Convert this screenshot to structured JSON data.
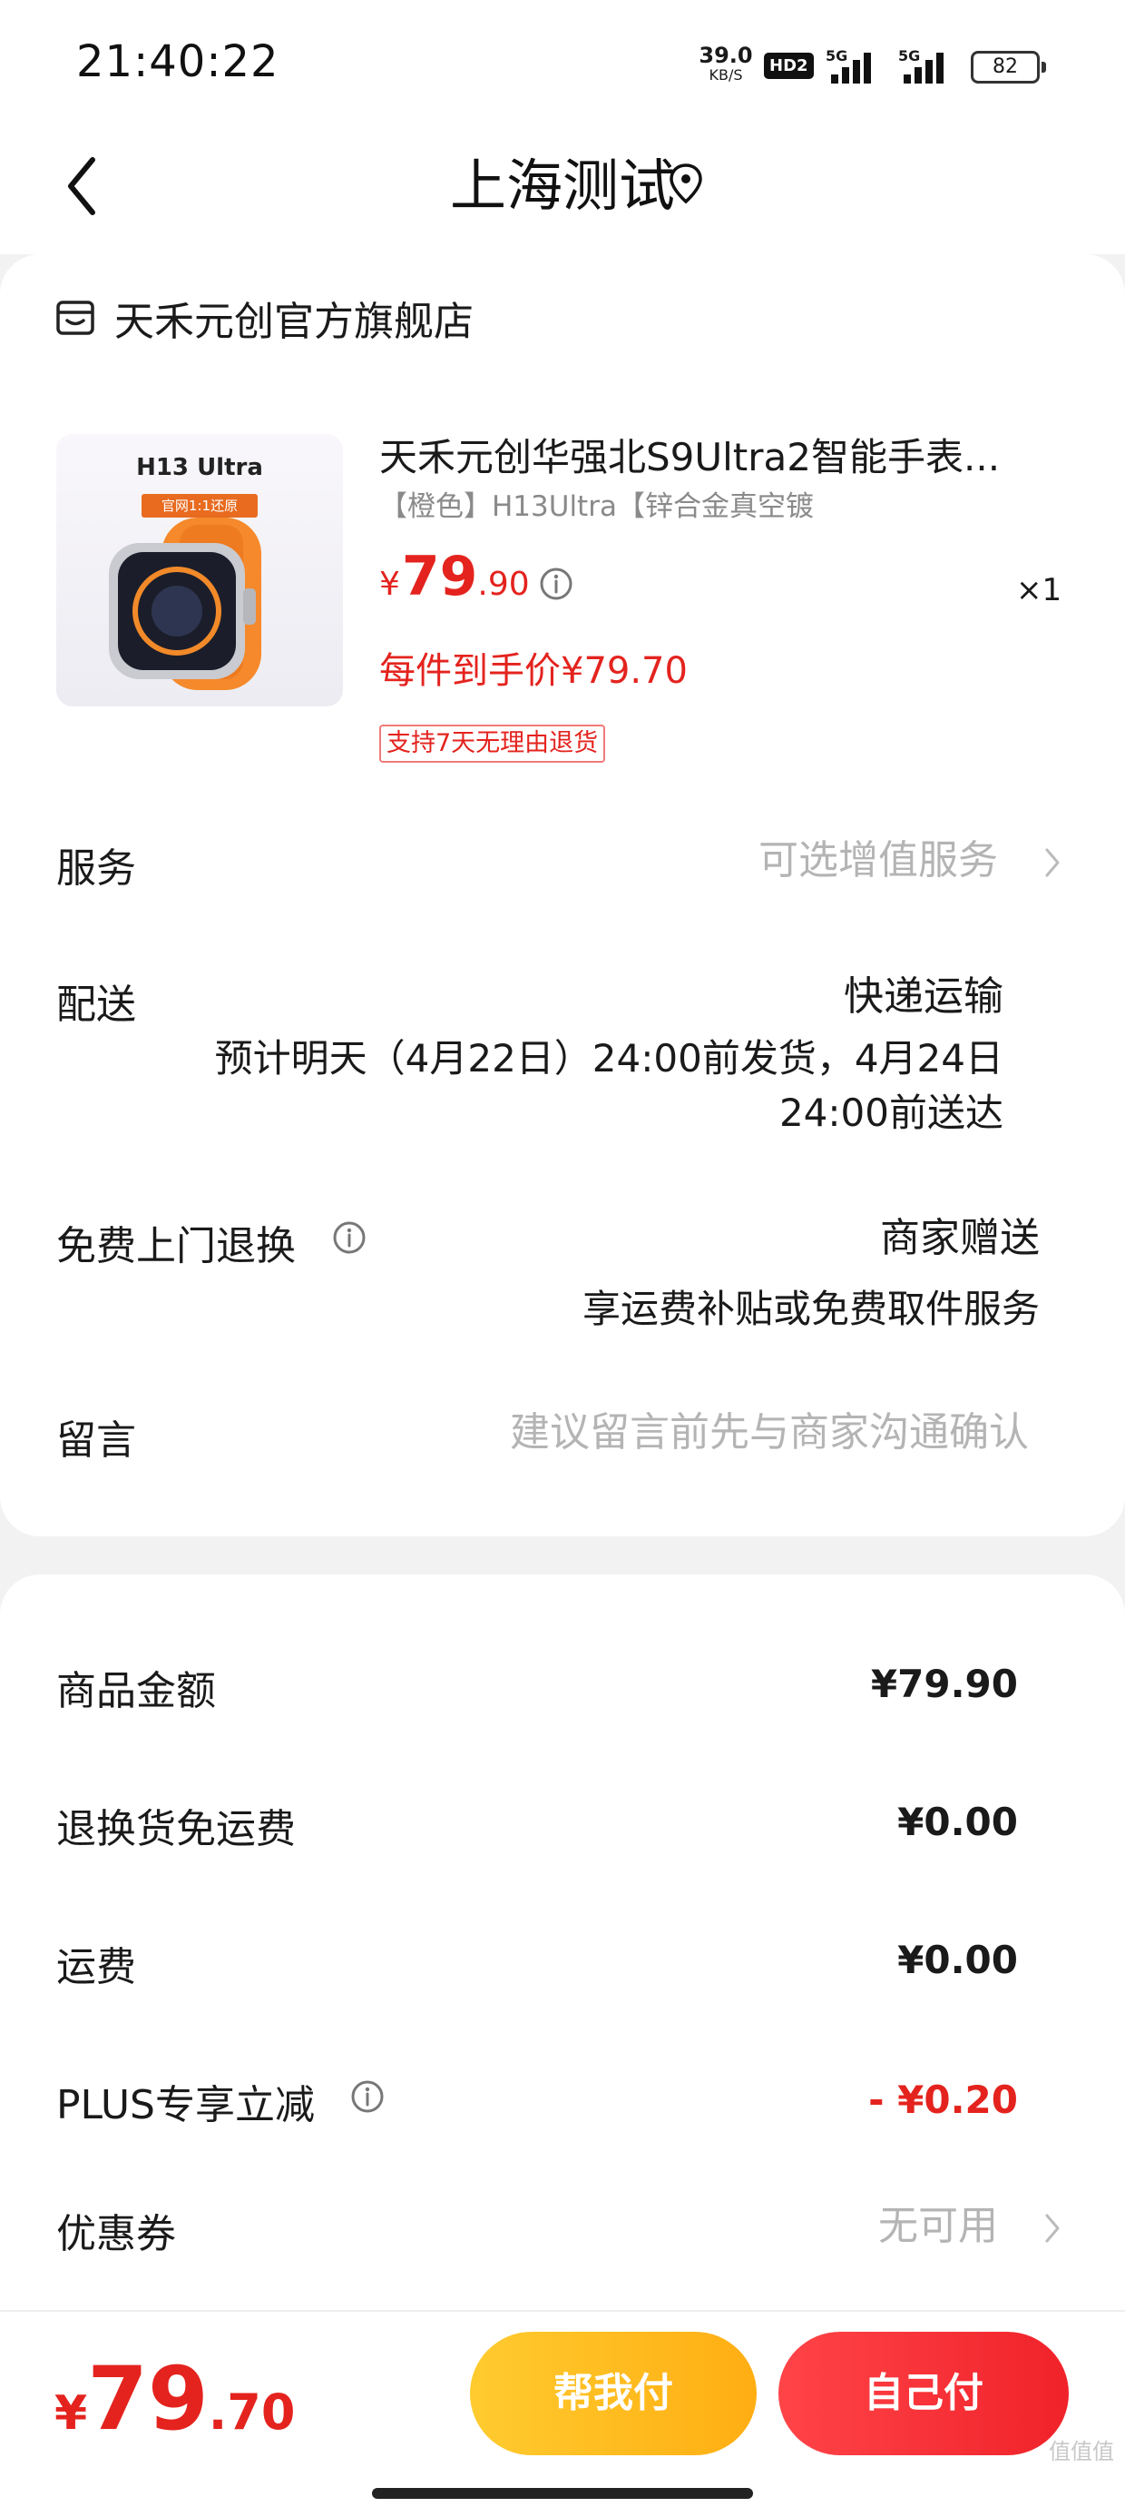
{
  "status_bar": {
    "time": "21:40:22",
    "net_speed_value": "39.0",
    "net_speed_unit": "KB/S",
    "hd_badge": "HD2",
    "sim1_label": "5G",
    "sim2_label": "5G",
    "battery": "82"
  },
  "header": {
    "title": "上海测试",
    "back_icon": "chevron-left-icon",
    "location_icon": "location-pin-icon"
  },
  "order": {
    "store_name": "天禾元创官方旗舰店",
    "store_icon": "store-icon",
    "product": {
      "thumb_title": "H13 Ultra",
      "thumb_sub": "官网1:1还原",
      "title": "天禾元创华强北S9Ultra2智能手表...",
      "spec": "【橙色】H13Ultra【锌合金真空镀",
      "price_currency": "¥",
      "price_int": "79",
      "price_dec": ".90",
      "qty": "×1",
      "each_price": "每件到手价¥79.70",
      "return_badge": "支持7天无理由退货"
    },
    "service": {
      "label": "服务",
      "value": "可选增值服务"
    },
    "delivery": {
      "label": "配送",
      "method": "快递运输",
      "eta_line1": "预计明天（4月22日）24:00前发货，4月24日",
      "eta_line2": "24:00前送达"
    },
    "return_pickup": {
      "label": "免费上门退换",
      "value": "商家赠送",
      "desc": "享运费补贴或免费取件服务"
    },
    "message": {
      "label": "留言",
      "placeholder": "建议留言前先与商家沟通确认"
    }
  },
  "summary": {
    "goods_amount": {
      "label": "商品金额",
      "value": "¥79.90"
    },
    "return_shipping": {
      "label": "退换货免运费",
      "value": "¥0.00"
    },
    "shipping": {
      "label": "运费",
      "value": "¥0.00"
    },
    "plus_discount": {
      "label": "PLUS专享立减",
      "value": "- ¥0.20"
    },
    "coupon": {
      "label": "优惠券",
      "value": "无可用"
    }
  },
  "footer": {
    "total_currency": "¥",
    "total_int": "79",
    "total_dec": ".70",
    "help_pay_label": "帮我付",
    "self_pay_label": "自己付",
    "watermark": "值值值"
  },
  "colors": {
    "accent_red": "#e4231e",
    "help_button": "#ffb81c",
    "pay_button": "#f0222a"
  }
}
